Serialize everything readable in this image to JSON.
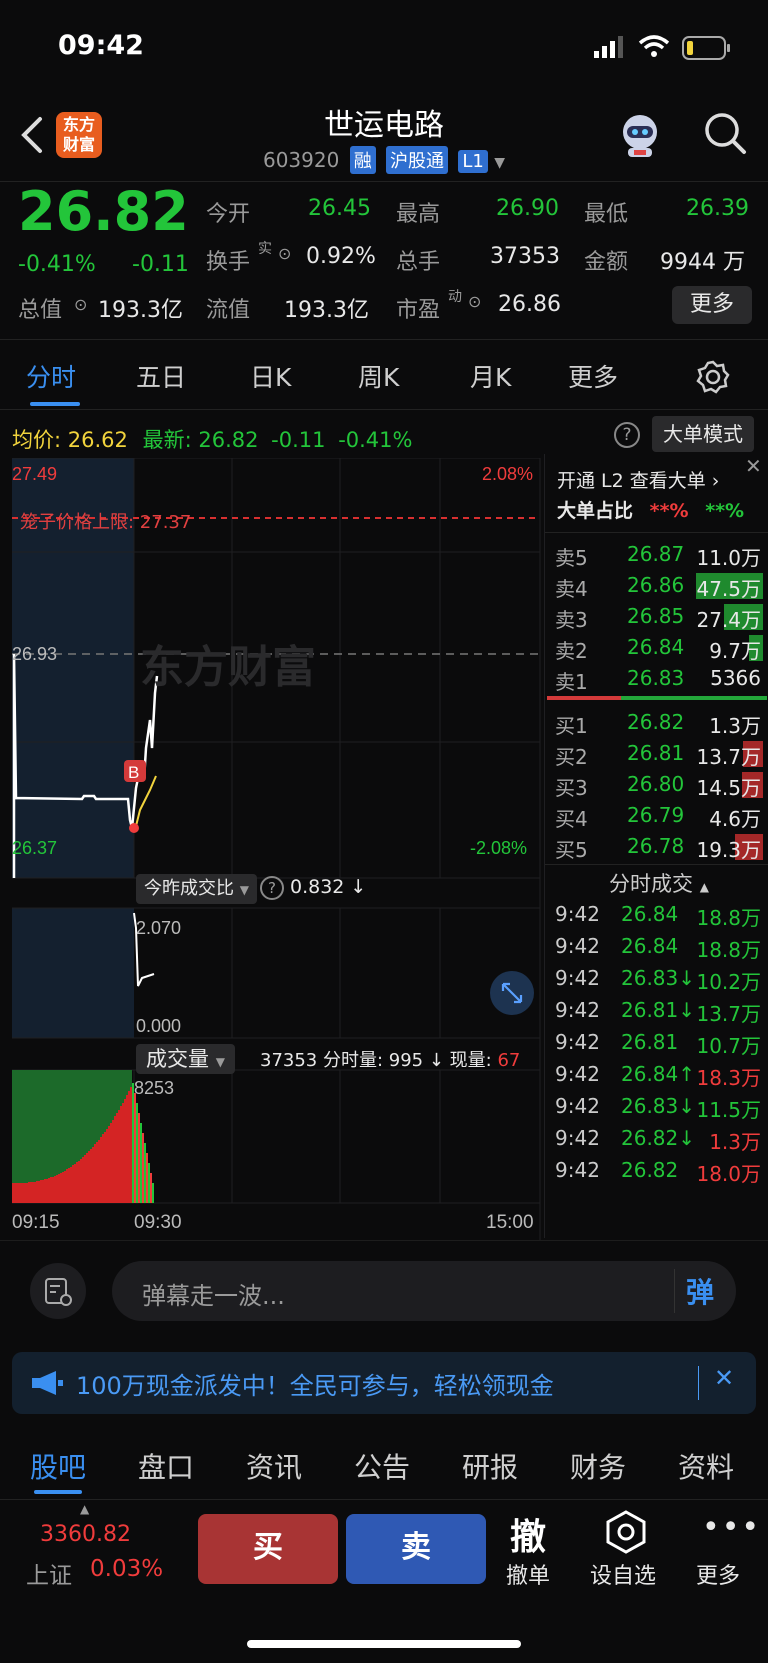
{
  "status": {
    "time": "09:42"
  },
  "header": {
    "name": "世运电路",
    "code": "603920",
    "tags": [
      "融",
      "沪股通",
      "L1"
    ],
    "logo_line1": "东方",
    "logo_line2": "财富"
  },
  "quote": {
    "price": "26.82",
    "pct": "-0.41%",
    "chg": "-0.11",
    "open_label": "今开",
    "open": "26.45",
    "high_label": "最高",
    "high": "26.90",
    "low_label": "最低",
    "low": "26.39",
    "turnover_label": "换手",
    "turnover_sup": "实",
    "turnover": "0.92%",
    "vol_label": "总手",
    "vol": "37353",
    "amount_label": "金额",
    "amount": "9944 万",
    "mktcap_label": "总值",
    "mktcap": "193.3亿",
    "float_label": "流值",
    "float": "193.3亿",
    "pe_label": "市盈",
    "pe_sup": "动",
    "pe": "26.86",
    "more": "更多"
  },
  "tabs": [
    "分时",
    "五日",
    "日K",
    "周K",
    "月K",
    "更多"
  ],
  "chart_info": {
    "avg_label": "均价:",
    "avg": "26.62",
    "last_label": "最新:",
    "last": "26.82",
    "chg": "-0.11",
    "pct": "-0.41%",
    "big_order_mode": "大单模式"
  },
  "chart_data": {
    "type": "line",
    "price_top": "27.49",
    "price_mid": "26.93",
    "price_bottom": "26.37",
    "pct_top": "2.08%",
    "pct_bottom": "-2.08%",
    "limit_label": "笼子价格上限: 27.37",
    "watermark": "东方财富",
    "marker": "B",
    "ratio_label": "今昨成交比",
    "ratio_value": "0.832 ↓",
    "ratio_top": "2.070",
    "ratio_bottom": "0.000",
    "vol_label": "成交量",
    "vol_info": "37353 分时量: 995 ↓ 现量: ",
    "vol_now": "67",
    "vol_max": "8253",
    "times": [
      "09:15",
      "09:30",
      "15:00"
    ]
  },
  "orderbook": {
    "l2_text": "开通 L2 查看大单 ›",
    "ratio_label": "大单占比",
    "ratio_red": "**%",
    "ratio_green": "**%",
    "asks": [
      {
        "label": "卖5",
        "price": "26.87",
        "vol": "11.0万",
        "bar": 0
      },
      {
        "label": "卖4",
        "price": "26.86",
        "vol": "47.5万",
        "bar": 0.95
      },
      {
        "label": "卖3",
        "price": "26.85",
        "vol": "27.4万",
        "bar": 0.55
      },
      {
        "label": "卖2",
        "price": "26.84",
        "vol": "9.7万",
        "bar": 0.2
      },
      {
        "label": "卖1",
        "price": "26.83",
        "vol": "5366",
        "bar": 0
      }
    ],
    "bids": [
      {
        "label": "买1",
        "price": "26.82",
        "vol": "1.3万",
        "bar": 0
      },
      {
        "label": "买2",
        "price": "26.81",
        "vol": "13.7万",
        "bar": 0.28
      },
      {
        "label": "买3",
        "price": "26.80",
        "vol": "14.5万",
        "bar": 0.3
      },
      {
        "label": "买4",
        "price": "26.79",
        "vol": "4.6万",
        "bar": 0
      },
      {
        "label": "买5",
        "price": "26.78",
        "vol": "19.3万",
        "bar": 0.4
      }
    ],
    "trades_title": "分时成交",
    "trades": [
      {
        "time": "9:42",
        "price": "26.84",
        "vol": "18.8万",
        "color": "green"
      },
      {
        "time": "9:42",
        "price": "26.84",
        "vol": "18.8万",
        "color": "green"
      },
      {
        "time": "9:42",
        "price": "26.83↓",
        "vol": "10.2万",
        "color": "green"
      },
      {
        "time": "9:42",
        "price": "26.81↓",
        "vol": "13.7万",
        "color": "green"
      },
      {
        "time": "9:42",
        "price": "26.81",
        "vol": "10.7万",
        "color": "green"
      },
      {
        "time": "9:42",
        "price": "26.84↑",
        "vol": "18.3万",
        "color": "red"
      },
      {
        "time": "9:42",
        "price": "26.83↓",
        "vol": "11.5万",
        "color": "green"
      },
      {
        "time": "9:42",
        "price": "26.82↓",
        "vol": "1.3万",
        "color": "red"
      },
      {
        "time": "9:42",
        "price": "26.82",
        "vol": "18.0万",
        "color": "red"
      }
    ]
  },
  "danmu": {
    "placeholder": "弹幕走一波...",
    "btn": "弹"
  },
  "notice": {
    "text": "100万现金派发中！全民可参与，轻松领现金"
  },
  "bottom_tabs": [
    "股吧",
    "盘口",
    "资讯",
    "公告",
    "研报",
    "财务",
    "资料"
  ],
  "toolbar": {
    "index_value": "3360.82",
    "index_name": "上证",
    "index_pct": "0.03%",
    "buy": "买",
    "sell": "卖",
    "cancel_glyph": "撤",
    "cancel": "撤单",
    "watch": "设自选",
    "more": "更多"
  },
  "colors": {
    "up": "#f03c3c",
    "down": "#23c53a",
    "accent": "#3a8ff0"
  }
}
